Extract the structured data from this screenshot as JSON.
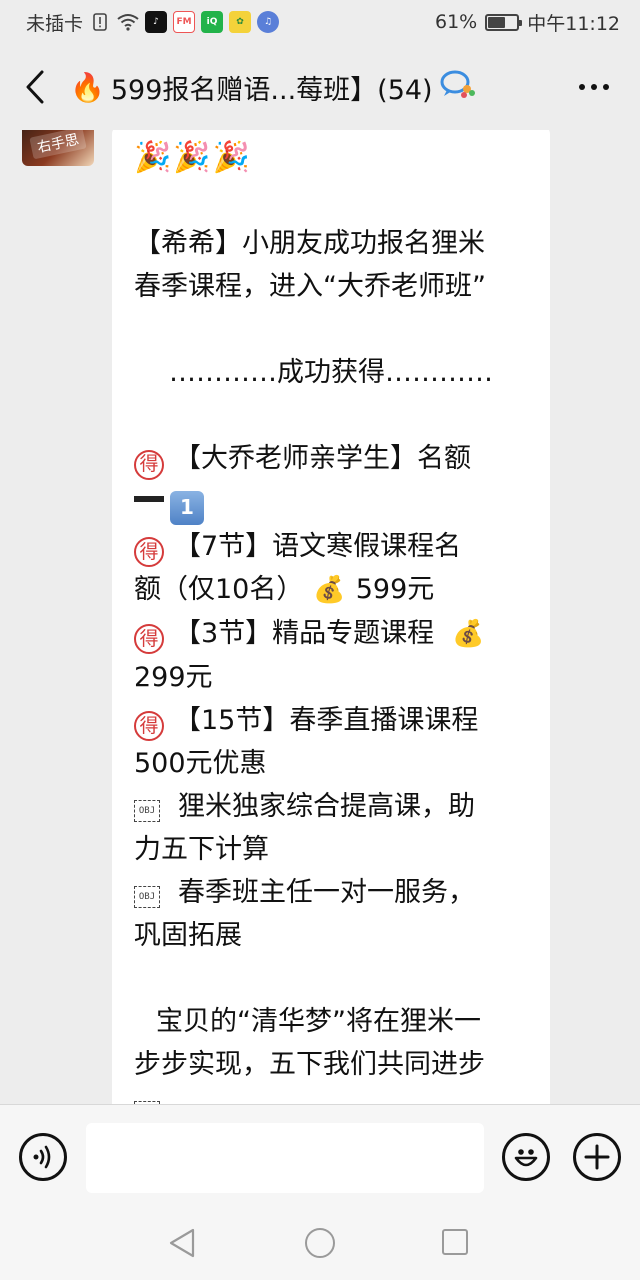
{
  "status_bar": {
    "carrier": "未插卡",
    "battery_percent": "61%",
    "battery_level": 0.61,
    "time": "中午11:12",
    "icons": [
      "sim-alert-icon",
      "wifi-icon",
      "tiktok-app-icon",
      "fm-app-icon",
      "iqiyi-app-icon",
      "app-icon",
      "music-app-icon"
    ]
  },
  "header": {
    "title_emoji": "🔥",
    "title": "599报名赠语...莓班】(54)",
    "back_icon": "chevron-left-icon",
    "more_icon": "more-dots-icon"
  },
  "message": {
    "sender_avatar_text": "右手思",
    "party_emojis": "🎉🎉🎉",
    "lines": {
      "intro_1": "【希希】小朋友成功报名狸米",
      "intro_2": "春季课程，进入“大乔老师班”",
      "obtain": "…………成功获得…………",
      "de_mark": "得",
      "item1_a": "【大乔老师亲学生】名额",
      "item1_keycap": "1",
      "item2_a": "【7节】语文寒假课程名",
      "item2_b": "额（仅10名）",
      "item2_price": "599元",
      "item3_a": "【3节】精品专题课程",
      "item3_price": "299元",
      "item4_a": "【15节】春季直播课课程",
      "item4_b": "500元优惠",
      "obj_mark": "OBJ",
      "item5_a": "狸米独家综合提高课，助",
      "item5_b": "力五下计算",
      "item6_a": "春季班主任一对一服务，",
      "item6_b": "巩固拓展",
      "closing_1": "宝贝的“清华梦”将在狸米一",
      "closing_2": "步步实现，五下我们共同进步"
    },
    "money_bag": "💰"
  },
  "input_bar": {
    "voice_icon": "voice-icon",
    "emoji_icon": "emoji-icon",
    "plus_icon": "plus-icon",
    "placeholder": ""
  },
  "nav_bar": {
    "icons": [
      "nav-back-icon",
      "nav-home-icon",
      "nav-recent-icon"
    ]
  }
}
